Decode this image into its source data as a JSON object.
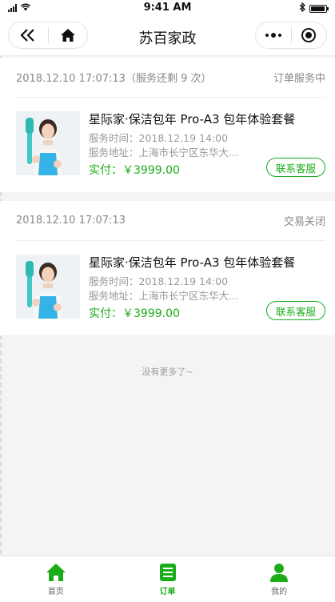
{
  "status_bar": {
    "time": "9:41 AM"
  },
  "nav": {
    "title": "苏百家政"
  },
  "orders": [
    {
      "timestamp": "2018.12.10 17:07:13（服务还剩 9 次）",
      "status": "订单服务中",
      "product_name": "星际家·保洁包年 Pro-A3 包年体验套餐",
      "service_time": "服务时间：2018.12.19 14:00",
      "service_address": "服务地址：上海市长宁区东华大…",
      "price": "实付：￥3999.00",
      "contact_label": "联系客服"
    },
    {
      "timestamp": "2018.12.10 17:07:13",
      "status": "交易关闭",
      "product_name": "星际家·保洁包年 Pro-A3 包年体验套餐",
      "service_time": "服务时间：2018.12.19 14:00",
      "service_address": "服务地址：上海市长宁区东华大…",
      "price": "实付：￥3999.00",
      "contact_label": "联系客服"
    }
  ],
  "footer_note": "没有更多了~",
  "tabs": [
    {
      "label": "首页",
      "icon": "home-icon"
    },
    {
      "label": "订单",
      "icon": "order-list-icon",
      "active": true
    },
    {
      "label": "我的",
      "icon": "profile-icon"
    }
  ],
  "colors": {
    "accent": "#1aad19",
    "muted_text": "#999999",
    "background": "#f4f4f6"
  }
}
